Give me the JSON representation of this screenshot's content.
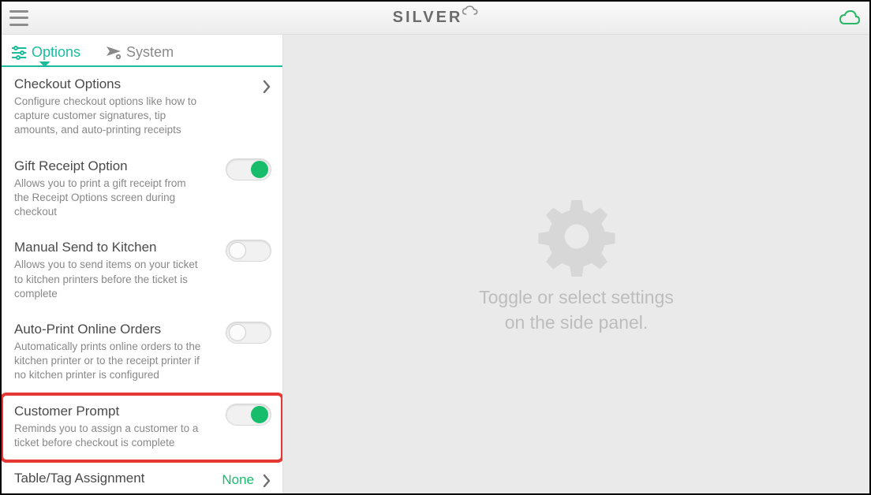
{
  "brand": "SILVER",
  "tabs": {
    "options": "Options",
    "system": "System"
  },
  "items": {
    "checkout": {
      "title": "Checkout Options",
      "desc": "Configure checkout options like how to capture customer signatures, tip amounts, and auto-printing receipts"
    },
    "gift": {
      "title": "Gift Receipt Option",
      "desc": "Allows you to print a gift receipt from the Receipt Options screen during checkout"
    },
    "manual": {
      "title": "Manual Send to Kitchen",
      "desc": "Allows you to send items on your ticket to kitchen printers before the ticket is complete"
    },
    "auto": {
      "title": "Auto-Print Online Orders",
      "desc": "Automatically prints online orders to the kitchen printer or to the receipt printer if no kitchen printer is configured"
    },
    "customer": {
      "title": "Customer Prompt",
      "desc": "Reminds you to assign a customer to a ticket before checkout is complete"
    },
    "table": {
      "title": "Table/Tag Assignment",
      "value": "None"
    }
  },
  "main": {
    "line1": "Toggle or select settings",
    "line2": "on the side panel."
  }
}
